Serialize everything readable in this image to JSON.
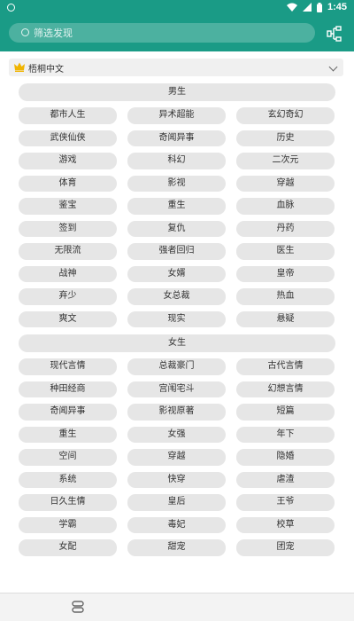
{
  "status_bar": {
    "time": "1:45"
  },
  "search": {
    "placeholder": "筛选发现"
  },
  "source": {
    "name": "梧桐中文"
  },
  "categories": [
    {
      "title": "男生",
      "tags": [
        "都市人生",
        "异术超能",
        "玄幻奇幻",
        "武侠仙侠",
        "奇闻异事",
        "历史",
        "游戏",
        "科幻",
        "二次元",
        "体育",
        "影视",
        "穿越",
        "鉴宝",
        "重生",
        "血脉",
        "签到",
        "复仇",
        "丹药",
        "无限流",
        "强者回归",
        "医生",
        "战神",
        "女婿",
        "皇帝",
        "弃少",
        "女总裁",
        "热血",
        "爽文",
        "现实",
        "悬疑"
      ]
    },
    {
      "title": "女生",
      "tags": [
        "现代言情",
        "总裁豪门",
        "古代言情",
        "种田经商",
        "宫闱宅斗",
        "幻想言情",
        "奇闻异事",
        "影视原著",
        "短篇",
        "重生",
        "女强",
        "年下",
        "空间",
        "穿越",
        "隐婚",
        "系统",
        "快穿",
        "虐渣",
        "日久生情",
        "皇后",
        "王爷",
        "学霸",
        "毒妃",
        "校草",
        "女配",
        "甜宠",
        "团宠"
      ]
    }
  ]
}
